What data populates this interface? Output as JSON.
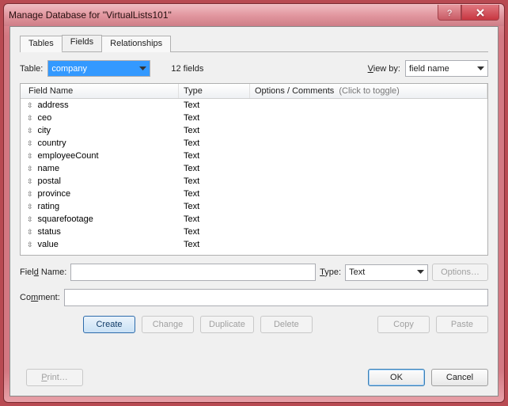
{
  "window": {
    "title": "Manage Database for \"VirtualLists101\""
  },
  "tabs": [
    {
      "label": "Tables"
    },
    {
      "label": "Fields"
    },
    {
      "label": "Relationships"
    }
  ],
  "active_tab": 1,
  "toolbar": {
    "table_label": "Table:",
    "table_selected": "company",
    "field_count": "12 fields",
    "viewby_label": "View by:",
    "viewby_prefix": "V",
    "viewby_rest": "iew by:",
    "viewby_selected": "field name"
  },
  "grid": {
    "col1": "Field Name",
    "col2": "Type",
    "col3": "Options / Comments",
    "toggle_hint": "(Click to toggle)",
    "rows": [
      {
        "name": "address",
        "type": "Text"
      },
      {
        "name": "ceo",
        "type": "Text"
      },
      {
        "name": "city",
        "type": "Text"
      },
      {
        "name": "country",
        "type": "Text"
      },
      {
        "name": "employeeCount",
        "type": "Text"
      },
      {
        "name": "name",
        "type": "Text"
      },
      {
        "name": "postal",
        "type": "Text"
      },
      {
        "name": "province",
        "type": "Text"
      },
      {
        "name": "rating",
        "type": "Text"
      },
      {
        "name": "squarefootage",
        "type": "Text"
      },
      {
        "name": "status",
        "type": "Text"
      },
      {
        "name": "value",
        "type": "Text"
      }
    ]
  },
  "form": {
    "fieldname_label_pre": "Fiel",
    "fieldname_label_u": "d",
    "fieldname_label_post": " Name:",
    "fieldname_value": "",
    "type_label": "Type:",
    "type_label_u": "T",
    "type_label_rest": "ype:",
    "type_selected": "Text",
    "options_btn": "Options…",
    "comment_label": "Co",
    "comment_label_u": "m",
    "comment_label_post": "ment:",
    "comment_value": ""
  },
  "buttons": {
    "create": "Create",
    "change": "Change",
    "duplicate": "Duplicate",
    "delete": "Delete",
    "copy": "Copy",
    "paste": "Paste"
  },
  "footer": {
    "print": "Print…",
    "ok": "OK",
    "cancel": "Cancel"
  }
}
